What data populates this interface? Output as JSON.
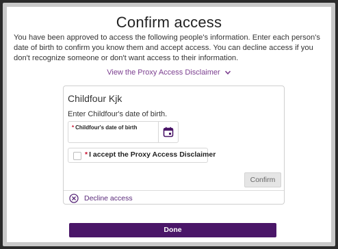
{
  "modal": {
    "title": "Confirm access",
    "intro": "You have been approved to access the following people's information. Enter each person's date of birth to confirm you know them and accept access. You can decline access if you don't recognize someone or don't want access to their information.",
    "disclaimer_link": "View the Proxy Access Disclaimer",
    "done_label": "Done"
  },
  "card": {
    "name": "Childfour Kjk",
    "prompt": "Enter Childfour's date of birth.",
    "date_label": "Childfour's date of birth",
    "date_value": "",
    "required_mark": "*",
    "accept_label": "I accept the Proxy Access Disclaimer",
    "confirm_label": "Confirm",
    "decline_label": "Decline access"
  },
  "icons": {
    "calendar": "calendar-icon",
    "chevron": "chevron-down-icon",
    "decline": "circle-x-icon"
  },
  "colors": {
    "accent": "#4a1668",
    "link": "#7b3e8f",
    "required": "#c8102e"
  }
}
